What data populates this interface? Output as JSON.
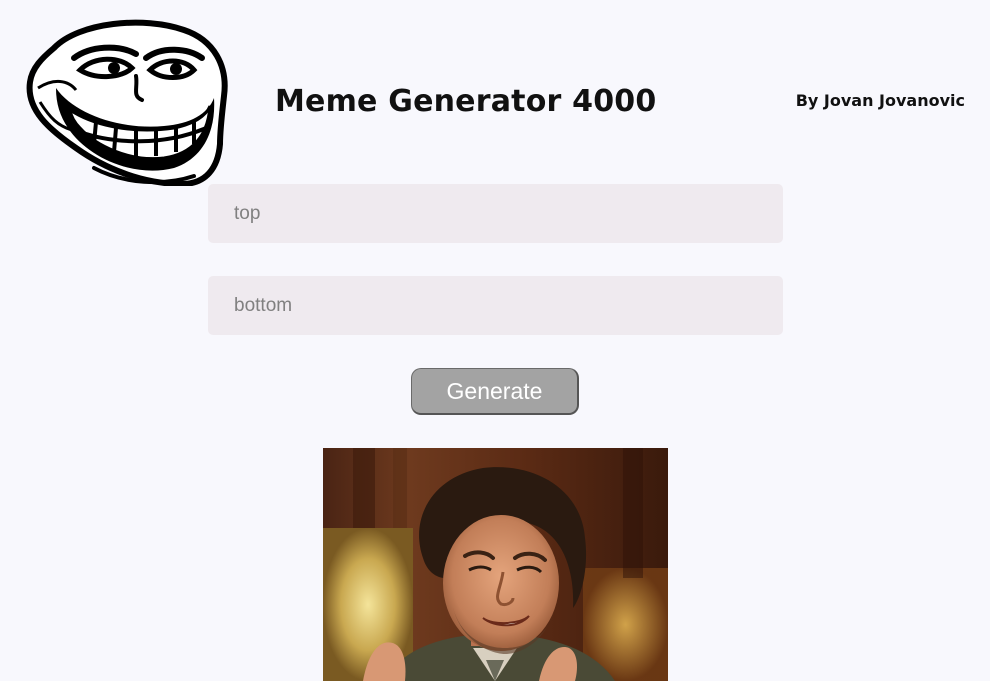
{
  "header": {
    "title": "Meme Generator 4000",
    "author": "By Jovan Jovanovic",
    "logo_icon": "trollface-icon"
  },
  "form": {
    "top_placeholder": "top",
    "top_value": "",
    "bottom_placeholder": "bottom",
    "bottom_value": "",
    "generate_label": "Generate"
  },
  "meme": {
    "image_icon": "meme-photo"
  },
  "colors": {
    "background": "#f8f8fd",
    "input_bg": "#efeaef",
    "button_bg": "#a3a3a3",
    "button_text": "#ffffff",
    "text": "#111111"
  }
}
